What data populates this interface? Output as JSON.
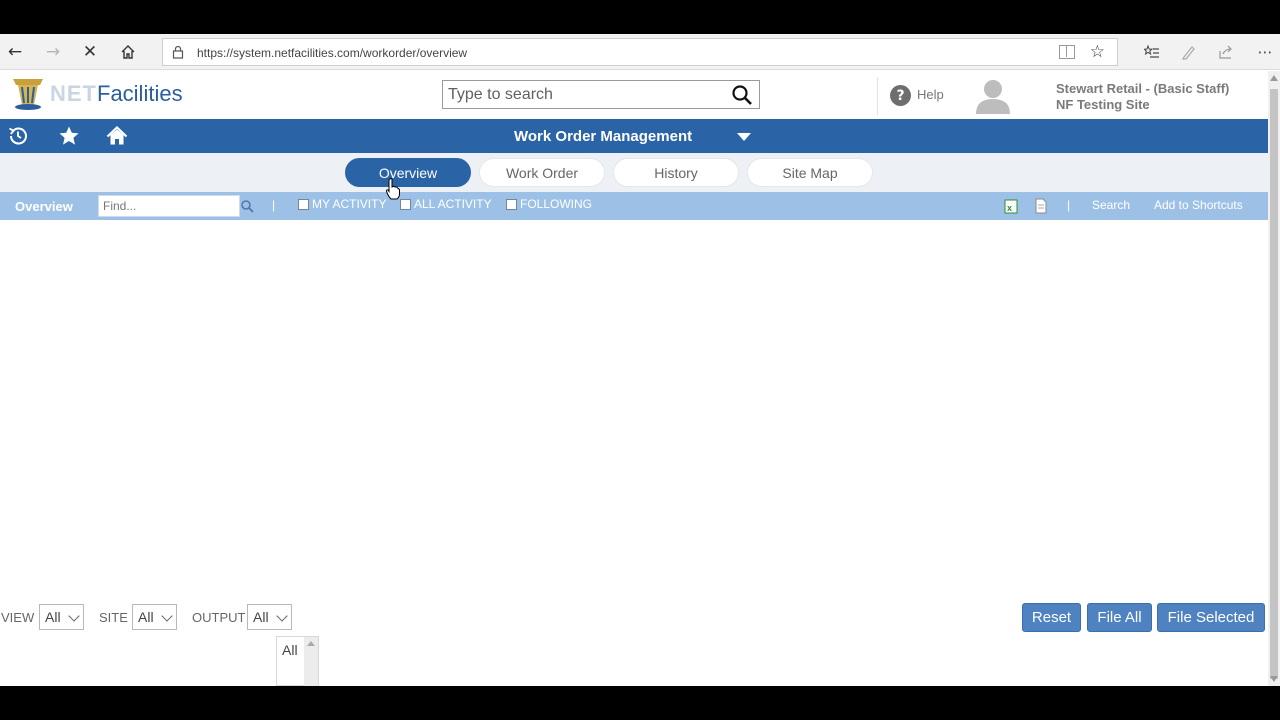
{
  "browser": {
    "url": "https://system.netfacilities.com/workorder/overview",
    "icons": [
      "back-icon",
      "forward-icon",
      "stop-icon",
      "home-icon",
      "lock-icon",
      "reading-view-icon",
      "favorite-star-icon",
      "favorites-list-icon",
      "pen-icon",
      "share-icon",
      "more-icon"
    ]
  },
  "header": {
    "logo_net": "NET",
    "logo_facilities": "Facilities",
    "search_placeholder": "Type to search",
    "help_label": "Help",
    "user_name": "Stewart Retail - (Basic Staff)",
    "user_site": "NF Testing Site"
  },
  "nav": {
    "title": "Work Order Management",
    "icons": [
      "history-icon",
      "star-icon",
      "home-icon",
      "caret-down-icon"
    ]
  },
  "tabs": [
    {
      "label": "Overview",
      "active": true
    },
    {
      "label": "Work Order",
      "active": false
    },
    {
      "label": "History",
      "active": false
    },
    {
      "label": "Site Map",
      "active": false
    }
  ],
  "filter_bar": {
    "label": "Overview",
    "find_placeholder": "Find...",
    "separator": "|",
    "checkboxes": [
      {
        "label": "MY ACTIVITY",
        "checked": false
      },
      {
        "label": "ALL ACTIVITY",
        "checked": false
      },
      {
        "label": "FOLLOWING",
        "checked": false
      }
    ],
    "search_link": "Search",
    "shortcuts_link": "Add to Shortcuts"
  },
  "bottom": {
    "view_label": "VIEW",
    "view_value": "All",
    "site_label": "SITE",
    "site_value": "All",
    "output_label": "OUTPUT",
    "output_value": "All",
    "list_item": "All",
    "reset_label": "Reset",
    "file_all_label": "File All",
    "file_selected_label": "File Selected"
  },
  "colors": {
    "brand_blue": "#2b63a7",
    "filter_bar": "#9dc1e6",
    "button_blue": "#4e82c0"
  }
}
